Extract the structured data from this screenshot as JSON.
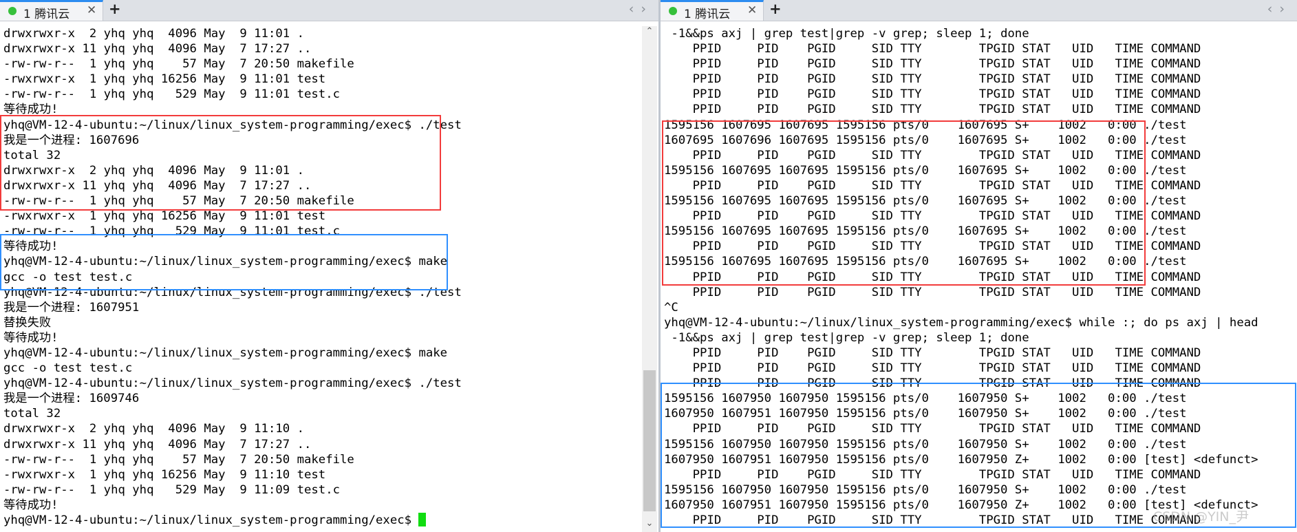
{
  "colors": {
    "highlight_red": "#f23b3b",
    "highlight_blue": "#2f8fff",
    "cursor": "#11dd11",
    "tab_status_dot": "#36c03b"
  },
  "left": {
    "tab": {
      "label": "1 腾讯云",
      "status_icon": "green-dot-icon",
      "close_icon": "close-icon"
    },
    "add_tab": "+",
    "nav": {
      "prev": "‹",
      "next": "›"
    },
    "lines": [
      "drwxrwxr-x  2 yhq yhq  4096 May  9 11:01 .",
      "drwxrwxr-x 11 yhq yhq  4096 May  7 17:27 ..",
      "-rw-rw-r--  1 yhq yhq    57 May  7 20:50 makefile",
      "-rwxrwxr-x  1 yhq yhq 16256 May  9 11:01 test",
      "-rw-rw-r--  1 yhq yhq   529 May  9 11:01 test.c",
      "等待成功!",
      "yhq@VM-12-4-ubuntu:~/linux/linux_system-programming/exec$ ./test",
      "我是一个进程: 1607696",
      "total 32",
      "drwxrwxr-x  2 yhq yhq  4096 May  9 11:01 .",
      "drwxrwxr-x 11 yhq yhq  4096 May  7 17:27 ..",
      "-rw-rw-r--  1 yhq yhq    57 May  7 20:50 makefile",
      "-rwxrwxr-x  1 yhq yhq 16256 May  9 11:01 test",
      "-rw-rw-r--  1 yhq yhq   529 May  9 11:01 test.c",
      "等待成功!",
      "yhq@VM-12-4-ubuntu:~/linux/linux_system-programming/exec$ make",
      "gcc -o test test.c",
      "yhq@VM-12-4-ubuntu:~/linux/linux_system-programming/exec$ ./test",
      "我是一个进程: 1607951",
      "替换失败",
      "等待成功!",
      "yhq@VM-12-4-ubuntu:~/linux/linux_system-programming/exec$ make",
      "gcc -o test test.c",
      "yhq@VM-12-4-ubuntu:~/linux/linux_system-programming/exec$ ./test",
      "我是一个进程: 1609746",
      "total 32",
      "drwxrwxr-x  2 yhq yhq  4096 May  9 11:10 .",
      "drwxrwxr-x 11 yhq yhq  4096 May  7 17:27 ..",
      "-rw-rw-r--  1 yhq yhq    57 May  7 20:50 makefile",
      "-rwxrwxr-x  1 yhq yhq 16256 May  9 11:10 test",
      "-rw-rw-r--  1 yhq yhq   529 May  9 11:09 test.c",
      "等待成功!"
    ],
    "prompt_last": "yhq@VM-12-4-ubuntu:~/linux/linux_system-programming/exec$ "
  },
  "right": {
    "tab": {
      "label": "1 腾讯云",
      "status_icon": "green-dot-icon",
      "close_icon": "close-icon"
    },
    "add_tab": "+",
    "nav": {
      "prev": "‹",
      "next": "›"
    },
    "lines": [
      " -1&&ps axj | grep test|grep -v grep; sleep 1; done",
      "    PPID     PID    PGID     SID TTY        TPGID STAT   UID   TIME COMMAND",
      "    PPID     PID    PGID     SID TTY        TPGID STAT   UID   TIME COMMAND",
      "    PPID     PID    PGID     SID TTY        TPGID STAT   UID   TIME COMMAND",
      "    PPID     PID    PGID     SID TTY        TPGID STAT   UID   TIME COMMAND",
      "    PPID     PID    PGID     SID TTY        TPGID STAT   UID   TIME COMMAND",
      "1595156 1607695 1607695 1595156 pts/0    1607695 S+    1002   0:00 ./test",
      "1607695 1607696 1607695 1595156 pts/0    1607695 S+    1002   0:00 ./test",
      "    PPID     PID    PGID     SID TTY        TPGID STAT   UID   TIME COMMAND",
      "1595156 1607695 1607695 1595156 pts/0    1607695 S+    1002   0:00 ./test",
      "    PPID     PID    PGID     SID TTY        TPGID STAT   UID   TIME COMMAND",
      "1595156 1607695 1607695 1595156 pts/0    1607695 S+    1002   0:00 ./test",
      "    PPID     PID    PGID     SID TTY        TPGID STAT   UID   TIME COMMAND",
      "1595156 1607695 1607695 1595156 pts/0    1607695 S+    1002   0:00 ./test",
      "    PPID     PID    PGID     SID TTY        TPGID STAT   UID   TIME COMMAND",
      "1595156 1607695 1607695 1595156 pts/0    1607695 S+    1002   0:00 ./test",
      "    PPID     PID    PGID     SID TTY        TPGID STAT   UID   TIME COMMAND",
      "    PPID     PID    PGID     SID TTY        TPGID STAT   UID   TIME COMMAND",
      "^C",
      "yhq@VM-12-4-ubuntu:~/linux/linux_system-programming/exec$ while :; do ps axj | head",
      " -1&&ps axj | grep test|grep -v grep; sleep 1; done",
      "    PPID     PID    PGID     SID TTY        TPGID STAT   UID   TIME COMMAND",
      "    PPID     PID    PGID     SID TTY        TPGID STAT   UID   TIME COMMAND",
      "    PPID     PID    PGID     SID TTY        TPGID STAT   UID   TIME COMMAND",
      "1595156 1607950 1607950 1595156 pts/0    1607950 S+    1002   0:00 ./test",
      "1607950 1607951 1607950 1595156 pts/0    1607950 S+    1002   0:00 ./test",
      "    PPID     PID    PGID     SID TTY        TPGID STAT   UID   TIME COMMAND",
      "1595156 1607950 1607950 1595156 pts/0    1607950 S+    1002   0:00 ./test",
      "1607950 1607951 1607950 1595156 pts/0    1607950 Z+    1002   0:00 [test] <defunct>",
      "    PPID     PID    PGID     SID TTY        TPGID STAT   UID   TIME COMMAND",
      "1595156 1607950 1607950 1595156 pts/0    1607950 S+    1002   0:00 ./test",
      "1607950 1607951 1607950 1595156 pts/0    1607950 Z+    1002   0:00 [test] <defunct>",
      "    PPID     PID    PGID     SID TTY        TPGID STAT   UID   TIME COMMAND"
    ]
  },
  "watermark": "CSDN @YIN_尹"
}
